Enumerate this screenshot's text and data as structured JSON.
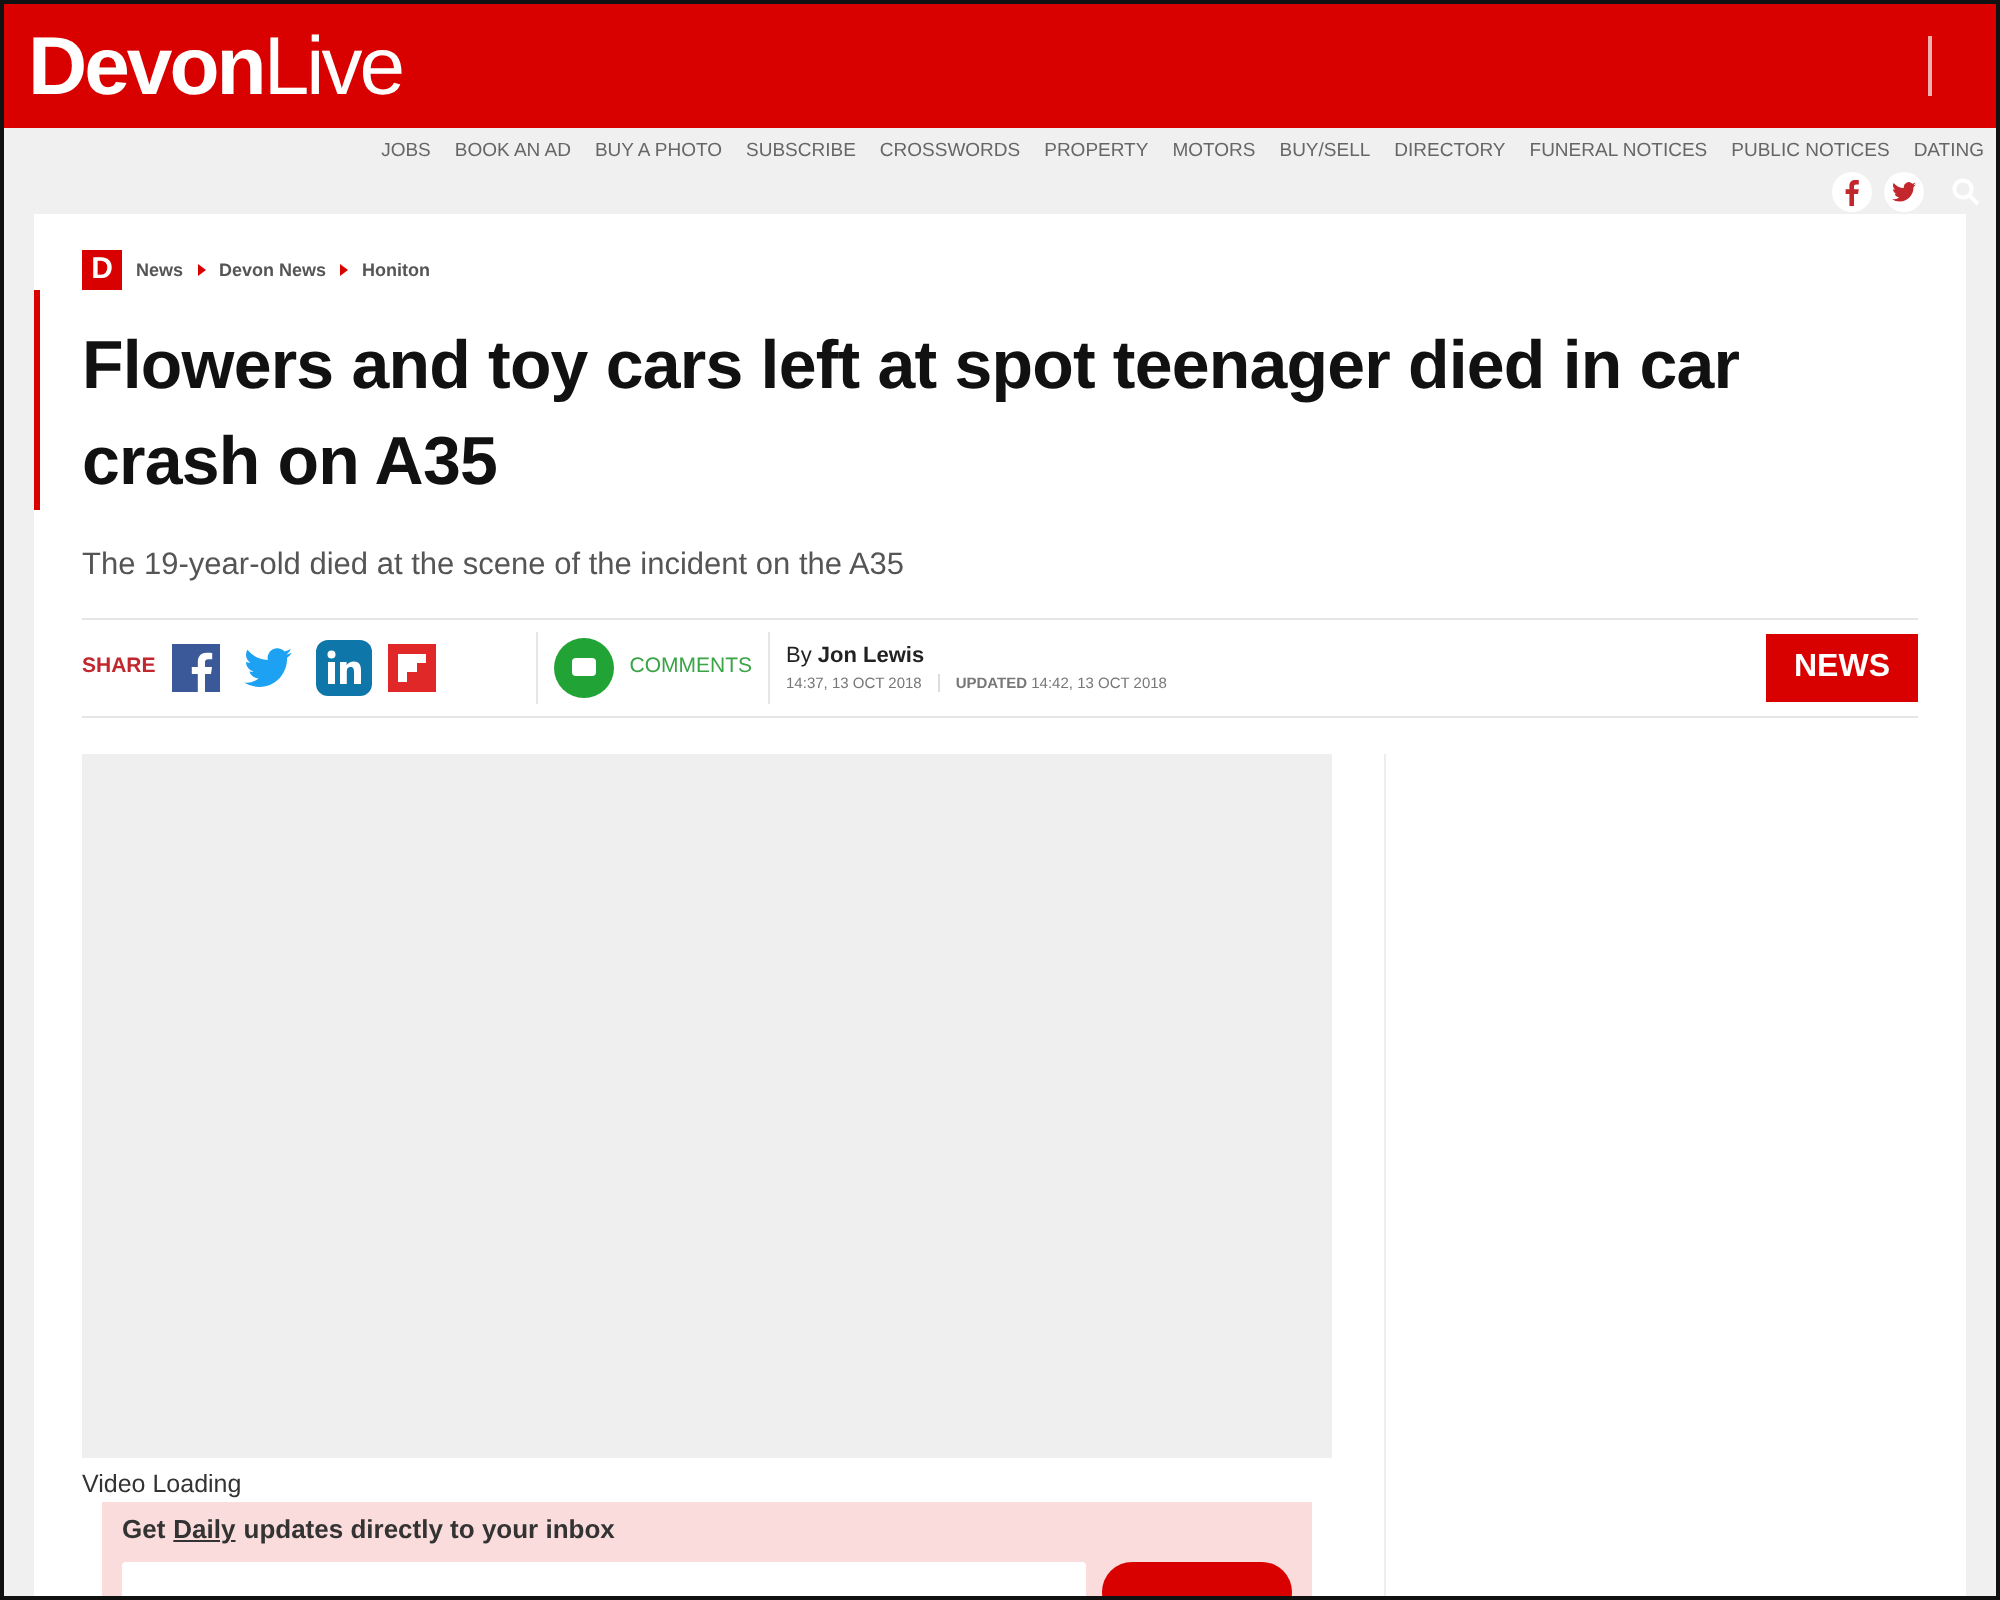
{
  "header": {
    "logo_bold": "Devon",
    "logo_light": "Live"
  },
  "top_links": [
    "JOBS",
    "BOOK AN AD",
    "BUY A PHOTO",
    "SUBSCRIBE",
    "CROSSWORDS",
    "PROPERTY",
    "MOTORS",
    "BUY/SELL",
    "DIRECTORY",
    "FUNERAL NOTICES",
    "PUBLIC NOTICES",
    "DATING"
  ],
  "breadcrumb": {
    "mark": "D",
    "items": [
      "News",
      "Devon News",
      "Honiton"
    ]
  },
  "article": {
    "headline": "Flowers and toy cars left at spot teenager died in car crash on A35",
    "standfirst": "The 19-year-old died at the scene of the incident on the A35",
    "share_label": "SHARE",
    "comments_label": "COMMENTS",
    "byline": "By **Jon Lewis**",
    "published": "14:37, 13 OCT 2018",
    "updated": "**UPDATED** 14:42, 13 OCT 2018",
    "section_tag": "NEWS",
    "video_status": "Video Loading"
  },
  "newsletter": {
    "prefix": "Get",
    "link": "Daily",
    "suffix": "updates directly to your inbox"
  }
}
